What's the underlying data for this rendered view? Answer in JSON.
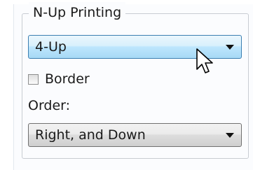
{
  "group": {
    "title": "N-Up Printing"
  },
  "layout_combo": {
    "value": "4-Up",
    "icon": "chevron-down-icon"
  },
  "border_checkbox": {
    "label": "Border",
    "checked": false
  },
  "order": {
    "label": "Order:",
    "value": "Right, and Down",
    "icon": "chevron-down-icon"
  },
  "colors": {
    "hover_border": "#3c7fb1",
    "hover_fill": "#bee6fd",
    "group_border": "#c8ccd2"
  }
}
